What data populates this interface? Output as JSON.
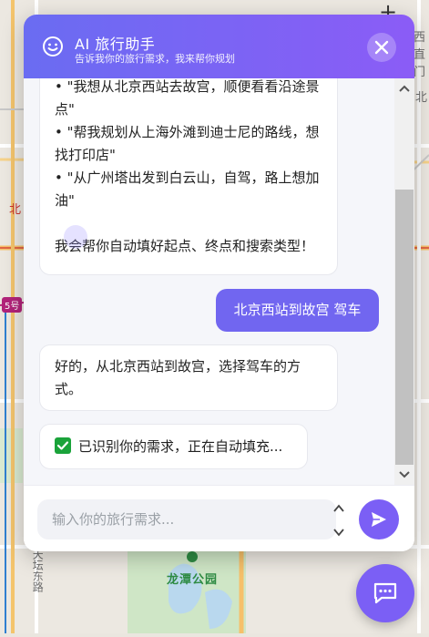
{
  "map": {
    "labels": {
      "top_right": "西直门",
      "right_mid": "北",
      "left_mid": "北",
      "metro_badge": "5号",
      "bottom_left": "天坛东路",
      "park": "龙潭公园"
    },
    "zoom_plus": "+"
  },
  "header": {
    "title": "AI 旅行助手",
    "subtitle": "告诉我你的旅行需求，我来帮你规划"
  },
  "messages": {
    "bot_1": {
      "lines": [
        "• \"我想从北京西站去故宫，顺便看看沿途景点\"",
        "• \"帮我规划从上海外滩到迪士尼的路线，想找打印店\"",
        "• \"从广州塔出发到白云山，自驾，路上想加油\"",
        "",
        "我会帮你自动填好起点、终点和搜索类型！"
      ]
    },
    "user_1": "北京西站到故宫 驾车",
    "bot_2": "好的，从北京西站到故宫，选择驾车的方式。",
    "bot_3": "已识别你的需求，正在自动填充..."
  },
  "input": {
    "placeholder": "输入你的旅行需求..."
  },
  "colors": {
    "accent": "#7b5ff5",
    "header_start": "#6a6cf2",
    "header_end": "#8b5cf6",
    "check": "#1aa33a"
  },
  "icons": {
    "header": "robot-face-icon",
    "close": "close-icon",
    "send": "send-icon",
    "toggle": "chat-bubble-icon",
    "check": "check-mark-icon"
  }
}
